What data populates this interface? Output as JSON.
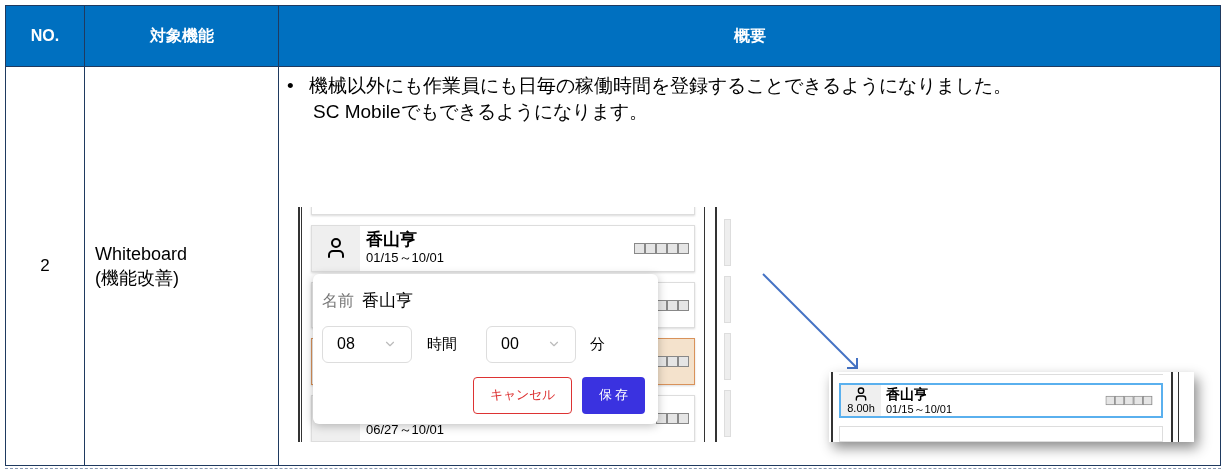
{
  "table": {
    "columns": [
      "NO.",
      "対象機能",
      "概要"
    ],
    "rows": [
      {
        "no": "2",
        "feature": [
          "Whiteboard",
          "(機能改善)"
        ],
        "summary": {
          "bullet": "•",
          "lines": [
            "機械以外にも作業員にも日毎の稼働時間を登録することできるようになりました。",
            "SC Mobileでもできるようになります。"
          ]
        },
        "screenshot_before": {
          "cards": [
            {
              "kind": "partial"
            },
            {
              "kind": "person",
              "name": "香山亨",
              "dates": "01/15～10/01",
              "highlighted": false
            },
            {
              "kind": "covered",
              "highlighted": false
            },
            {
              "kind": "covered",
              "highlighted": true
            },
            {
              "kind": "dates",
              "dates": "06/27～10/01",
              "highlighted": false
            }
          ],
          "popup": {
            "label": "名前",
            "name": "香山亨",
            "hours": "08",
            "hours_unit": "時間",
            "minutes": "00",
            "minutes_unit": "分",
            "cancel": "キャンセル",
            "save": "保 存"
          }
        },
        "screenshot_after": {
          "card": {
            "name": "香山亨",
            "hours": "8.00h",
            "dates": "01/15～10/01",
            "selected": true
          }
        }
      }
    ]
  }
}
